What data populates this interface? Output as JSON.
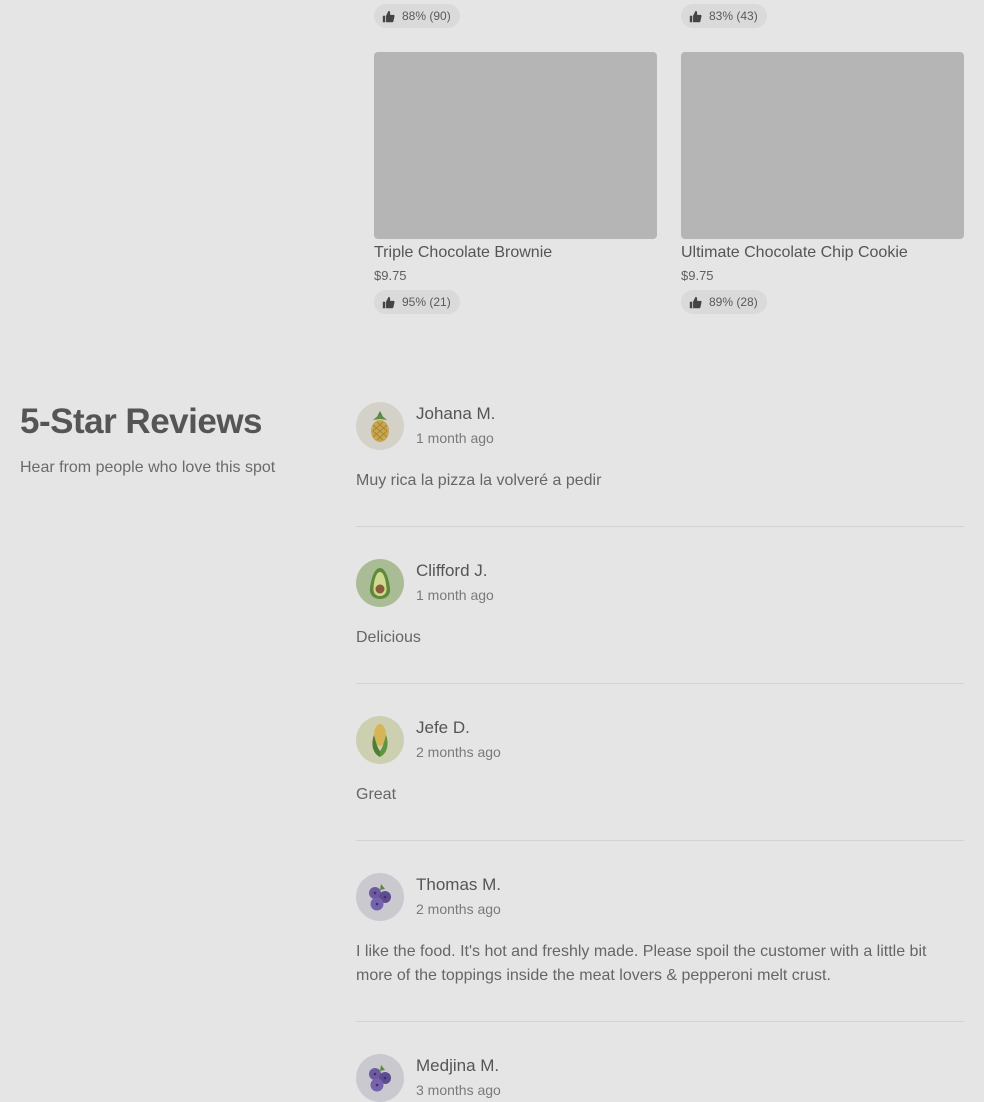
{
  "top_ratings": [
    {
      "label": "88% (90)"
    },
    {
      "label": "83% (43)"
    }
  ],
  "items": [
    {
      "name": "Triple Chocolate Brownie",
      "price": "$9.75",
      "rating": "95% (21)"
    },
    {
      "name": "Ultimate Chocolate Chip Cookie",
      "price": "$9.75",
      "rating": "89% (28)"
    }
  ],
  "reviews_section": {
    "title": "5-Star Reviews",
    "subtitle": "Hear from people who love this spot"
  },
  "reviews": [
    {
      "name": "Johana M.",
      "time": "1 month ago",
      "text": "Muy rica la pizza la volveré a pedir",
      "avatar_icon": "pineapple-icon"
    },
    {
      "name": "Clifford J.",
      "time": "1 month ago",
      "text": "Delicious",
      "avatar_icon": "avocado-icon"
    },
    {
      "name": "Jefe D.",
      "time": "2 months ago",
      "text": "Great",
      "avatar_icon": "corn-icon"
    },
    {
      "name": "Thomas M.",
      "time": "2 months ago",
      "text": "I like the food. It's hot and freshly made. Please spoil the customer with a little bit more of the toppings inside the meat lovers & pepperoni melt crust.",
      "avatar_icon": "blueberries-icon"
    },
    {
      "name": "Medjina M.",
      "time": "3 months ago",
      "text": "",
      "avatar_icon": "blueberries-icon"
    }
  ],
  "colors": {
    "background": "#e5e5e5",
    "pill": "#dadada",
    "thumbnail": "#b5b5b5"
  }
}
